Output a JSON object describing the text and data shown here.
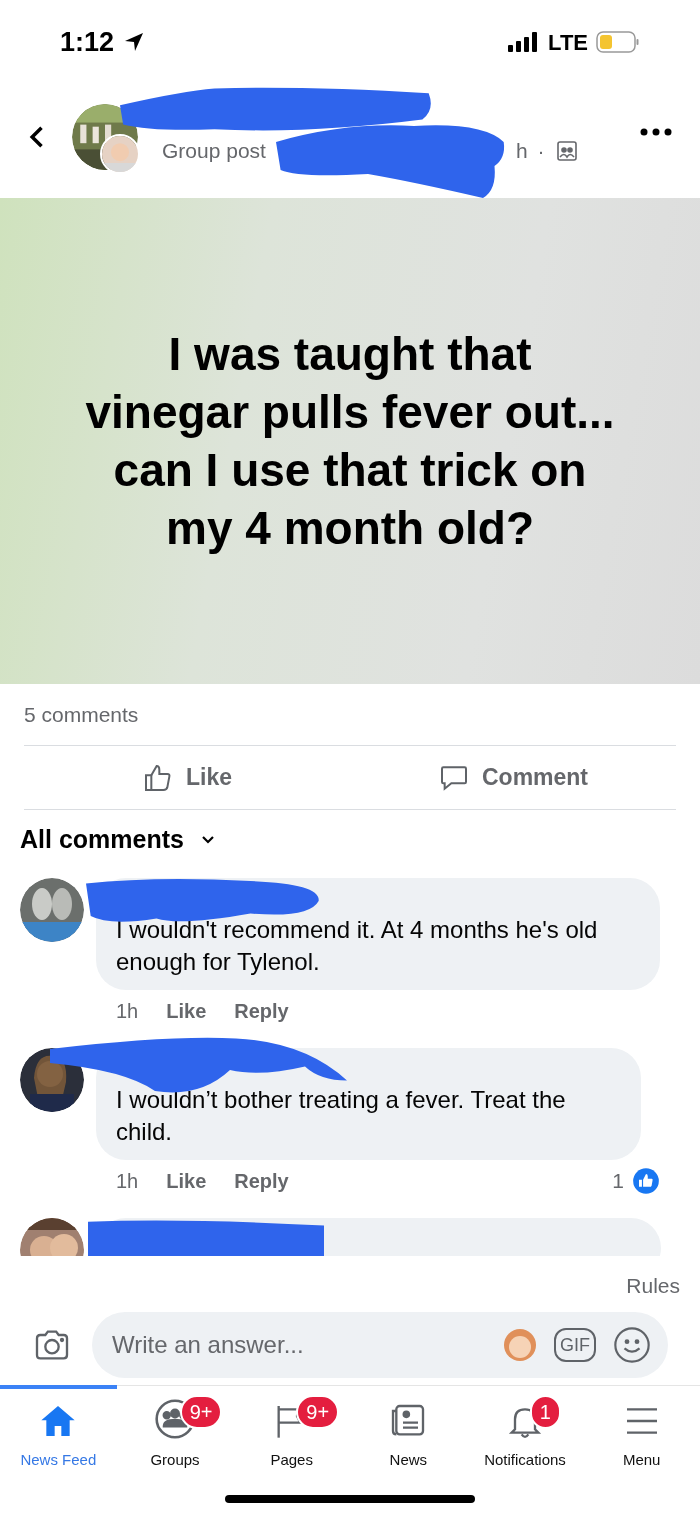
{
  "status_bar": {
    "time": "1:12",
    "network": "LTE"
  },
  "header": {
    "subtitle": "Group post",
    "age": "h",
    "separator": "·"
  },
  "post": {
    "text": "I was taught that vinegar pulls fever out... can I use that trick on my 4 month old?"
  },
  "comment_count": "5 comments",
  "actions": [
    {
      "kind": "like",
      "label": "Like"
    },
    {
      "kind": "comment",
      "label": "Comment"
    }
  ],
  "sort": {
    "label": "All comments"
  },
  "comments": [
    {
      "text": "I wouldn't recommend it. At 4 months he's old enough for Tylenol.",
      "time": "1h",
      "like": "Like",
      "reply": "Reply"
    },
    {
      "text": "I wouldn’t bother treating a fever. Treat the child.",
      "time": "1h",
      "like": "Like",
      "reply": "Reply",
      "reactions": "1"
    }
  ],
  "rules": "Rules",
  "composer": {
    "placeholder": "Write an answer...",
    "gif": "GIF"
  },
  "tabs": [
    {
      "kind": "home",
      "label": "News Feed",
      "selected": true
    },
    {
      "kind": "groups",
      "label": "Groups",
      "selected": false,
      "badge": "9+"
    },
    {
      "kind": "pages",
      "label": "Pages",
      "selected": false,
      "badge": "9+"
    },
    {
      "kind": "news",
      "label": "News",
      "selected": false
    },
    {
      "kind": "bell",
      "label": "Notifications",
      "selected": false,
      "badge": "1"
    },
    {
      "kind": "menu",
      "label": "Menu",
      "selected": false
    }
  ]
}
